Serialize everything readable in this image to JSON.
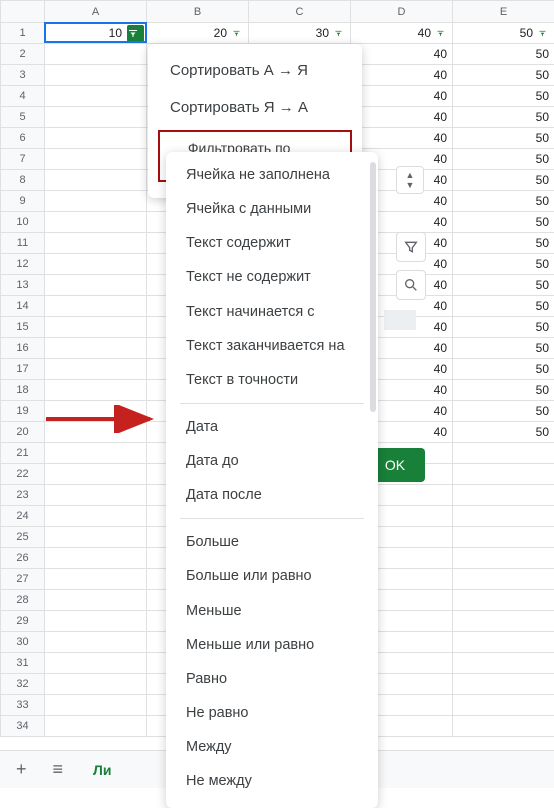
{
  "columns": [
    "A",
    "B",
    "C",
    "D",
    "E"
  ],
  "header_values": [
    10,
    20,
    30,
    40,
    50
  ],
  "data": {
    "D": [
      40,
      40,
      40,
      40,
      40,
      40,
      40,
      40,
      40,
      40,
      40,
      40,
      40,
      40,
      40,
      40,
      40,
      40,
      40
    ],
    "E": [
      50,
      50,
      50,
      50,
      50,
      50,
      50,
      50,
      50,
      50,
      50,
      50,
      50,
      50,
      50,
      50,
      50,
      50,
      50
    ]
  },
  "row_count": 34,
  "dropdown": {
    "sort_az": "Сортировать А → Я",
    "sort_za": "Сортировать Я → А",
    "filter_condition": "Фильтровать по условию..."
  },
  "conditions": {
    "empty": "Ячейка не заполнена",
    "notempty": "Ячейка с данными",
    "contains": "Текст содержит",
    "notcontains": "Текст не содержит",
    "starts": "Текст начинается с",
    "ends": "Текст заканчивается на",
    "exact": "Текст в точности",
    "date": "Дата",
    "datebefore": "Дата до",
    "dateafter": "Дата после",
    "gt": "Больше",
    "gte": "Больше или равно",
    "lt": "Меньше",
    "lte": "Меньше или равно",
    "eq": "Равно",
    "neq": "Не равно",
    "between": "Между",
    "notbetween": "Не между"
  },
  "ok_label": "OK",
  "footer": {
    "tab": "Ли"
  }
}
